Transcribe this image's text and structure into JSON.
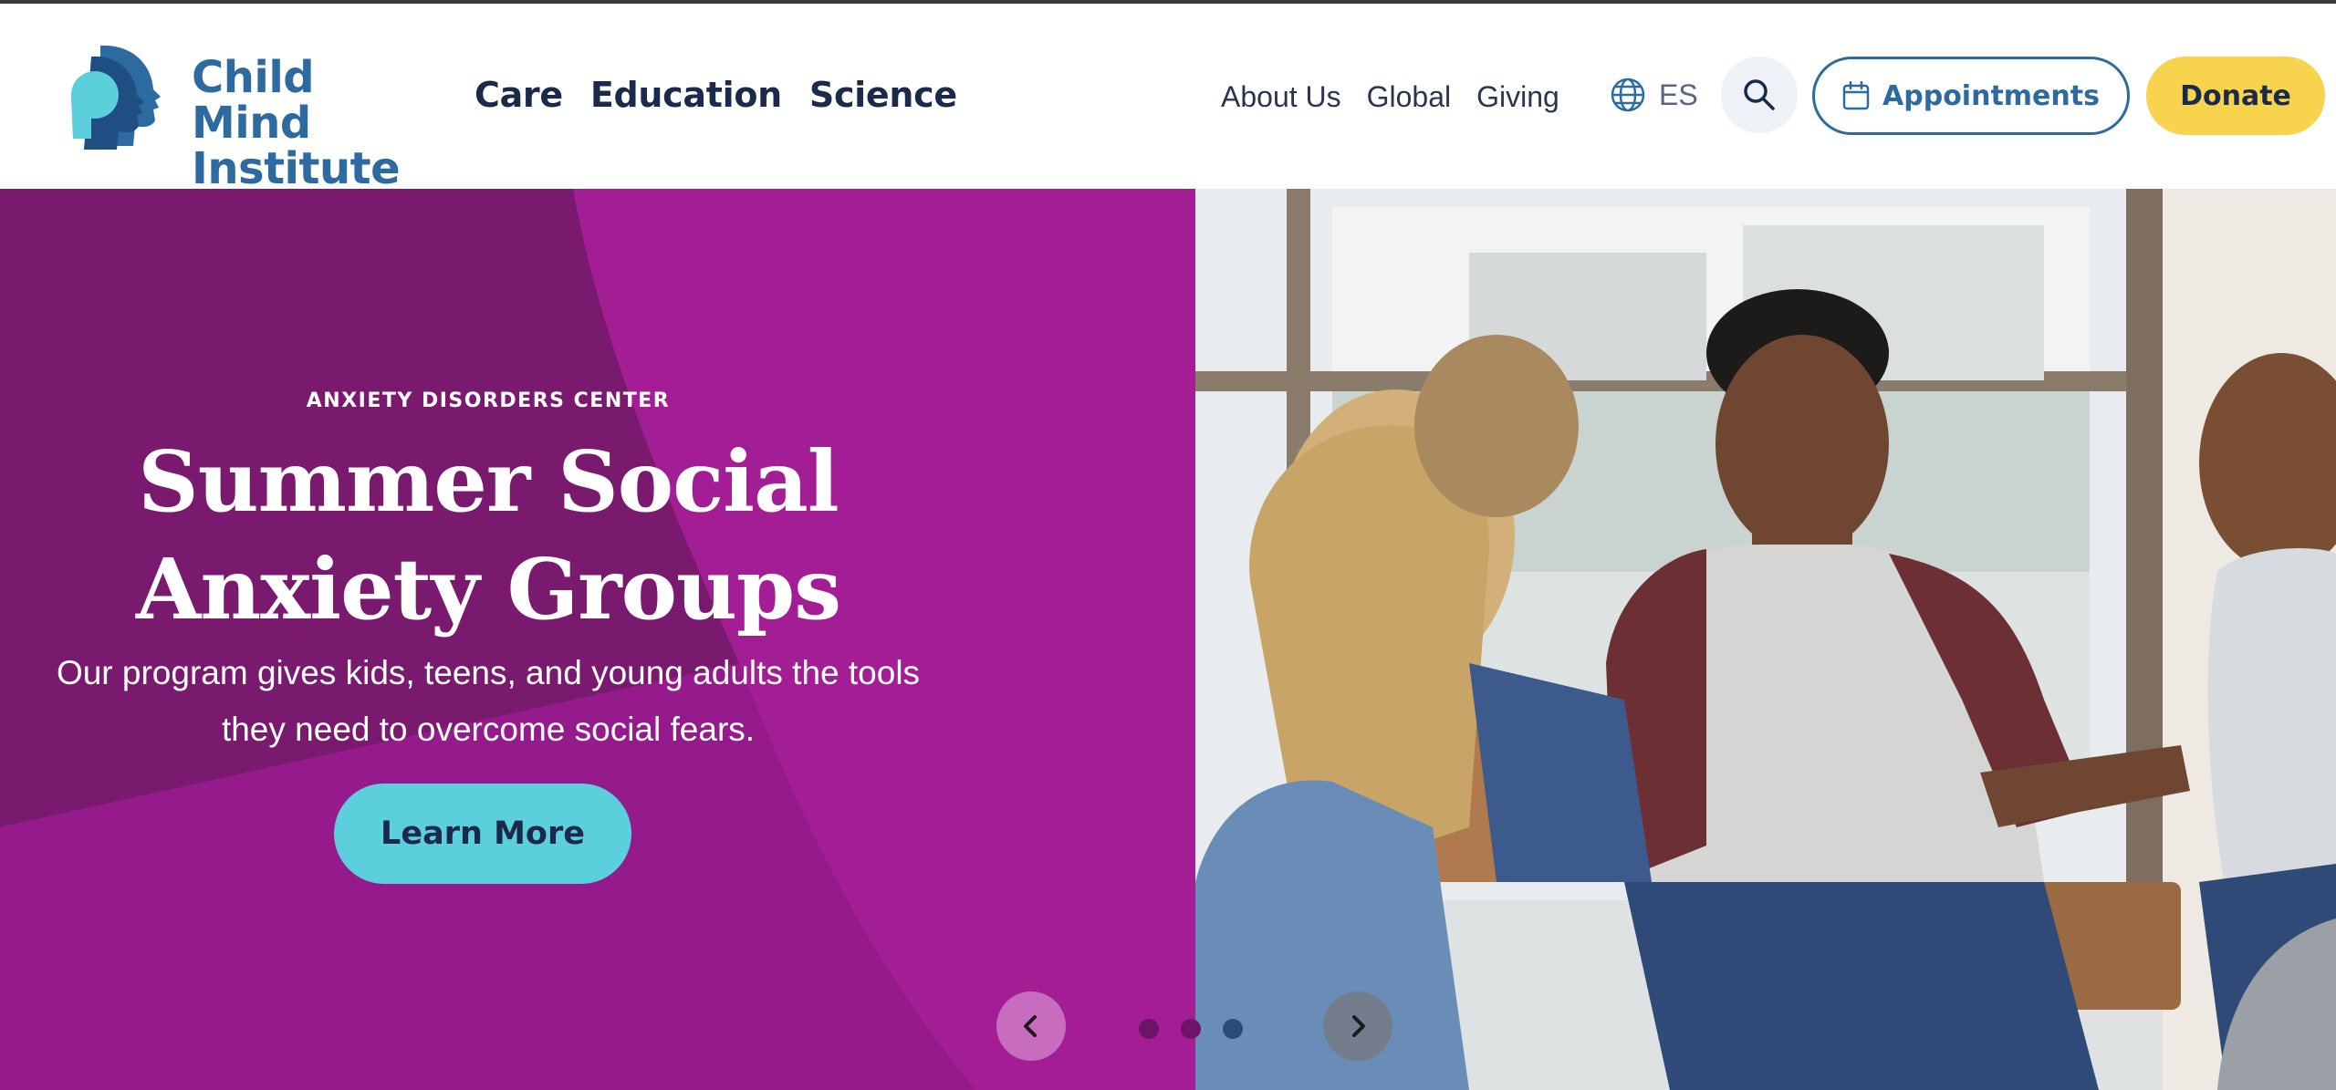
{
  "header": {
    "logo": {
      "line1": "Child Mind",
      "line2": "Institute"
    },
    "main_nav": [
      {
        "label": "Care"
      },
      {
        "label": "Education"
      },
      {
        "label": "Science"
      }
    ],
    "util_nav": [
      {
        "label": "About Us"
      },
      {
        "label": "Global"
      },
      {
        "label": "Giving"
      }
    ],
    "language": {
      "icon": "globe-icon",
      "label": "ES"
    },
    "search": {
      "icon": "search-icon"
    },
    "appointments": {
      "icon": "calendar-icon",
      "label": "Appointments"
    },
    "donate": {
      "label": "Donate"
    }
  },
  "hero": {
    "eyebrow": "ANXIETY DISORDERS CENTER",
    "headline_line1": "Summer Social",
    "headline_line2": "Anxiety Groups",
    "subcopy_line1": "Our program gives kids, teens, and young adults the tools",
    "subcopy_line2": "they need to overcome social fears.",
    "cta_label": "Learn More",
    "photo": "photo of a teen support group sitting in a circle by a window",
    "carousel": {
      "prev_icon": "chevron-left-icon",
      "next_icon": "chevron-right-icon",
      "slide_count": 3,
      "active_slide": 3
    }
  },
  "colors": {
    "brand_blue": "#2c6aa0",
    "navy": "#1b2a4a",
    "hero_magenta": "#a31e95",
    "hero_dark_magenta": "#7a1a6e",
    "cta_cyan": "#5ccfdd",
    "donate_yellow": "#f7d34e"
  }
}
